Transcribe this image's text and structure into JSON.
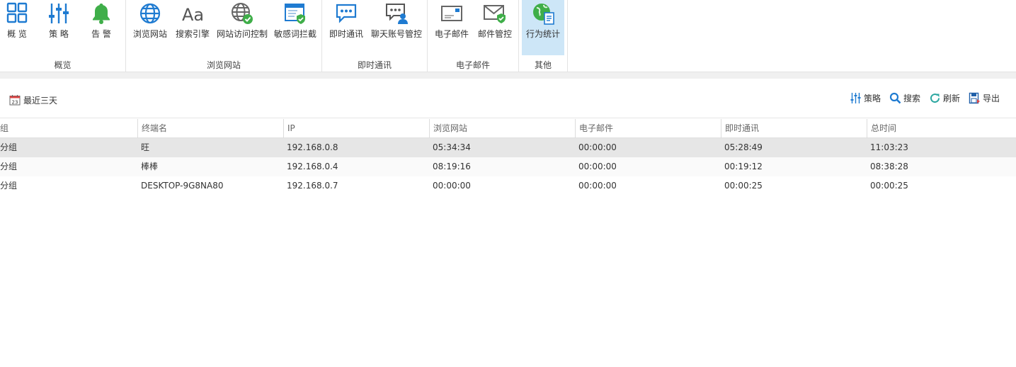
{
  "ribbon": {
    "groups": [
      {
        "title": "概览",
        "buttons": [
          {
            "label": "概 览",
            "icon": "overview-icon"
          },
          {
            "label": "策 略",
            "icon": "policy-sliders-icon"
          },
          {
            "label": "告 警",
            "icon": "alarm-bell-icon"
          }
        ]
      },
      {
        "title": "浏览网站",
        "buttons": [
          {
            "label": "浏览网站",
            "icon": "globe-icon"
          },
          {
            "label": "搜索引擎",
            "icon": "font-aa-icon"
          },
          {
            "label": "网站访问控制",
            "icon": "globe-check-icon"
          },
          {
            "label": "敏感词拦截",
            "icon": "window-shield-icon"
          }
        ]
      },
      {
        "title": "即时通讯",
        "buttons": [
          {
            "label": "即时通讯",
            "icon": "chat-bubble-icon"
          },
          {
            "label": "聊天账号管控",
            "icon": "chat-user-icon"
          }
        ]
      },
      {
        "title": "电子邮件",
        "buttons": [
          {
            "label": "电子邮件",
            "icon": "envelope-icon"
          },
          {
            "label": "邮件管控",
            "icon": "envelope-shield-icon"
          }
        ]
      },
      {
        "title": "其他",
        "buttons": [
          {
            "label": "行为统计",
            "icon": "behavior-stats-icon",
            "active": true
          }
        ]
      }
    ]
  },
  "toolbar": {
    "range_label": "最近三天",
    "calendar_day": "23",
    "tools": [
      {
        "label": "策略",
        "icon": "policy-sliders-icon"
      },
      {
        "label": "搜索",
        "icon": "search-icon"
      },
      {
        "label": "刷新",
        "icon": "refresh-icon"
      },
      {
        "label": "导出",
        "icon": "export-icon"
      }
    ]
  },
  "table": {
    "columns": [
      "分组",
      "终端名",
      "IP",
      "浏览网站",
      "电子邮件",
      "即时通讯",
      "总时间"
    ],
    "rows": [
      {
        "group": "未分组",
        "terminal": "旺",
        "ip": "192.168.0.8",
        "web": "05:34:34",
        "email": "00:00:00",
        "im": "05:28:49",
        "total": "11:03:23"
      },
      {
        "group": "未分组",
        "terminal": "棒棒",
        "ip": "192.168.0.4",
        "web": "08:19:16",
        "email": "00:00:00",
        "im": "00:19:12",
        "total": "08:38:28"
      },
      {
        "group": "未分组",
        "terminal": "DESKTOP-9G8NA80",
        "ip": "192.168.0.7",
        "web": "00:00:00",
        "email": "00:00:00",
        "im": "00:00:25",
        "total": "00:00:25"
      }
    ]
  },
  "colors": {
    "accent_blue": "#1f7bd1",
    "active_tab_bg": "#cde6f7",
    "alarm_green": "#3fae49",
    "selected_row": "#e6e6e6"
  }
}
